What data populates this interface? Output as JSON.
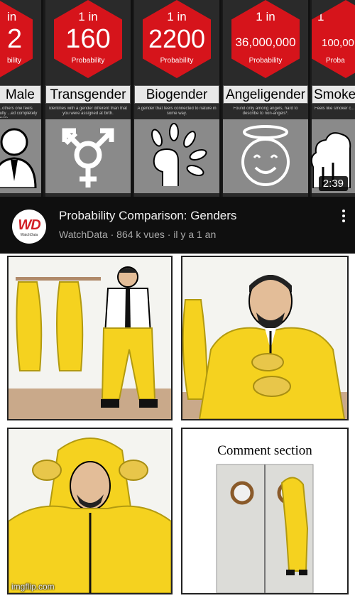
{
  "thumbnail": {
    "columns": [
      {
        "one_in": "in",
        "number": "2",
        "prob_label": "bility",
        "name": "Male",
        "desc": "...others one feels fully ...ed completely male.",
        "icon": "person-suit-icon"
      },
      {
        "one_in": "1 in",
        "number": "160",
        "prob_label": "Probability",
        "name": "Transgender",
        "desc": "Identifies with a gender different than that you were assigned at birth.",
        "icon": "transgender-symbol-icon"
      },
      {
        "one_in": "1 in",
        "number": "2200",
        "prob_label": "Probability",
        "name": "Biogender",
        "desc": "A gender that feels connected to nature in some way.",
        "icon": "leaf-head-icon"
      },
      {
        "one_in": "1 in",
        "number": "36,000,000",
        "prob_label": "Probability",
        "name": "Angeligender",
        "desc": "Found only among angels, hard to describe to non-angels*.",
        "icon": "angel-face-icon"
      },
      {
        "one_in": "1",
        "number": "100,00",
        "prob_label": "Proba",
        "name": "Smoke",
        "desc": "Feels like smoker c... deeper; it dis...",
        "icon": "smoke-cloud-icon"
      }
    ],
    "duration": "2:39"
  },
  "video": {
    "channel_logo": "WD",
    "channel_logo_sub": "WatchData",
    "title": "Probability Comparison: Genders",
    "meta": "WatchData · 864 k vues · il y a 1 an"
  },
  "comic": {
    "caption": "Comment section",
    "watermark": "imgflip.com"
  },
  "colors": {
    "hex_red": "#d6141b",
    "yt_bg": "#0f0f0f",
    "suit_yellow": "#f5d21f"
  }
}
